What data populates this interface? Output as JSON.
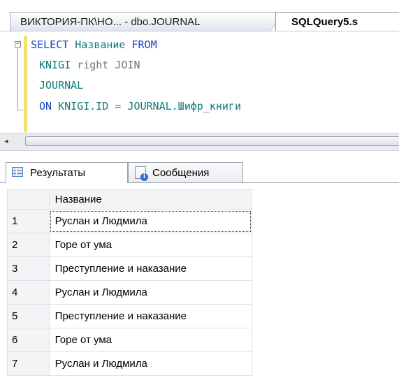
{
  "doc_tabs": [
    {
      "label": "ВИКТОРИЯ-ПК\\НО... - dbo.JOURNAL",
      "active": false
    },
    {
      "label": "SQLQuery5.s",
      "active": true
    }
  ],
  "editor": {
    "line1": {
      "kw1": "SELECT",
      "col": "Название",
      "kw2": "FROM"
    },
    "line2": {
      "table": "KNIGI",
      "join": "right JOIN"
    },
    "line3": {
      "table": "JOURNAL"
    },
    "line4": {
      "kw": "ON",
      "left": "KNIGI.ID",
      "op": "=",
      "right": "JOURNAL.Шифр_книги"
    }
  },
  "icons": {
    "collapse": "minus-box",
    "scroll_left": "◂",
    "results": "grid-icon",
    "messages": "message-icon"
  },
  "result_tabs": [
    {
      "label": "Результаты",
      "active": true
    },
    {
      "label": "Сообщения",
      "active": false
    }
  ],
  "grid": {
    "header": "Название",
    "rows": [
      {
        "n": "1",
        "value": "Руслан и Людмила"
      },
      {
        "n": "2",
        "value": "Горе от ума"
      },
      {
        "n": "3",
        "value": "Преступление и наказание"
      },
      {
        "n": "4",
        "value": "Руслан и Людмила"
      },
      {
        "n": "5",
        "value": "Преступление и наказание"
      },
      {
        "n": "6",
        "value": "Горе от ума"
      },
      {
        "n": "7",
        "value": "Руслан и Людмила"
      }
    ]
  },
  "colors": {
    "keyword": "#1a44c4",
    "identifier": "#117a7a",
    "change_bar": "#f2e36b"
  }
}
